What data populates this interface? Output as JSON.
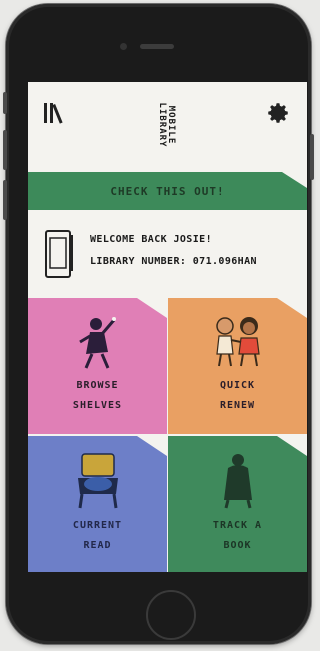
{
  "header": {
    "logo_text": "MOBILE LIBRARY"
  },
  "banner": {
    "label": "CHECK THIS OUT!",
    "color": "#3d8a5a"
  },
  "welcome": {
    "line1": "WELCOME BACK JOSIE!",
    "line2": "LIBRARY NUMBER: 071.096HAN"
  },
  "tiles": [
    {
      "line1": "BROWSE",
      "line2": "SHELVES",
      "color": "#e07fb6"
    },
    {
      "line1": "QUICK",
      "line2": "RENEW",
      "color": "#e9a063"
    },
    {
      "line1": "CURRENT",
      "line2": "READ",
      "color": "#6d7fc8"
    },
    {
      "line1": "TRACK A",
      "line2": "BOOK",
      "color": "#3f8a5c"
    }
  ]
}
